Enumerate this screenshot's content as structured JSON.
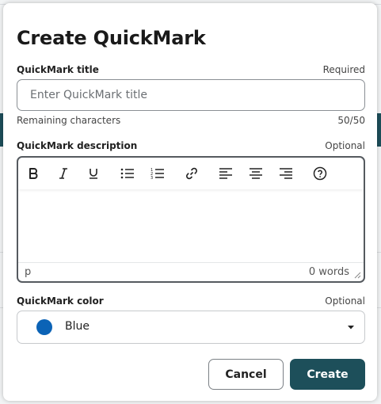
{
  "dialog": {
    "title": "Create QuickMark"
  },
  "title_field": {
    "label": "QuickMark title",
    "hint": "Required",
    "placeholder": "Enter QuickMark title",
    "value": "",
    "remaining_label": "Remaining characters",
    "remaining_count": "50/50"
  },
  "description_field": {
    "label": "QuickMark description",
    "hint": "Optional",
    "toolbar": [
      "bold-icon",
      "italic-icon",
      "underline-icon",
      "bullet-list-icon",
      "numbered-list-icon",
      "link-icon",
      "align-left-icon",
      "align-center-icon",
      "align-right-icon",
      "help-icon"
    ],
    "status_path": "p",
    "word_count": "0 words"
  },
  "color_field": {
    "label": "QuickMark color",
    "hint": "Optional",
    "selected": "Blue",
    "swatch_color": "#0b63b6"
  },
  "actions": {
    "cancel_label": "Cancel",
    "create_label": "Create"
  },
  "colors": {
    "primary": "#1d4f5a",
    "swatch_blue": "#0b63b6"
  }
}
